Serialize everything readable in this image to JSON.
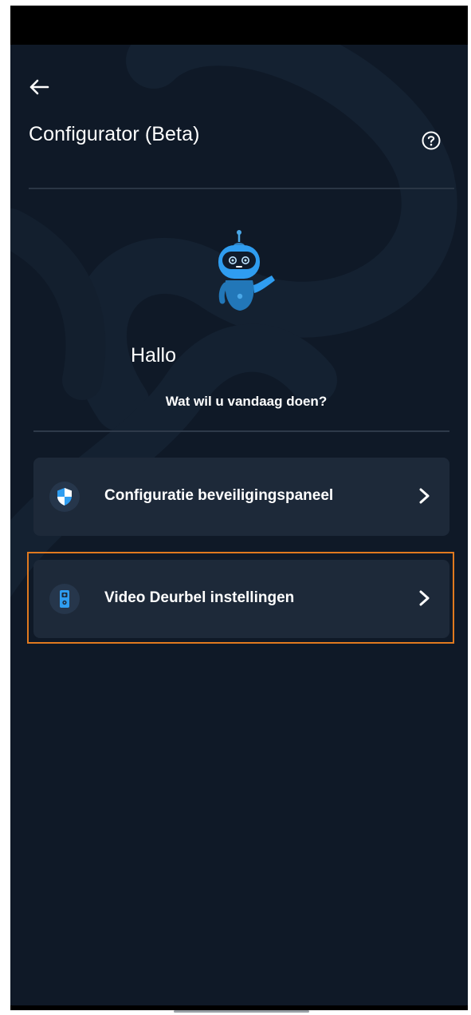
{
  "header": {
    "back_icon": "arrow-left-icon",
    "title": "Configurator (Beta)",
    "help_icon": "question-circle-icon"
  },
  "assistant": {
    "avatar_icon": "robot-icon",
    "greeting": "Hallo",
    "prompt": "Wat wil u vandaag doen?"
  },
  "options": [
    {
      "label": "Configuratie beveiligingspaneel",
      "icon": "shield-icon",
      "chevron_icon": "chevron-right-icon"
    },
    {
      "label": "Video Deurbel instellingen",
      "icon": "doorbell-icon",
      "chevron_icon": "chevron-right-icon"
    }
  ],
  "colors": {
    "background": "#0f1927",
    "card": "#1d2939",
    "accent_blue": "#2f9df0",
    "highlight": "#e0791f",
    "text": "#ffffff"
  }
}
